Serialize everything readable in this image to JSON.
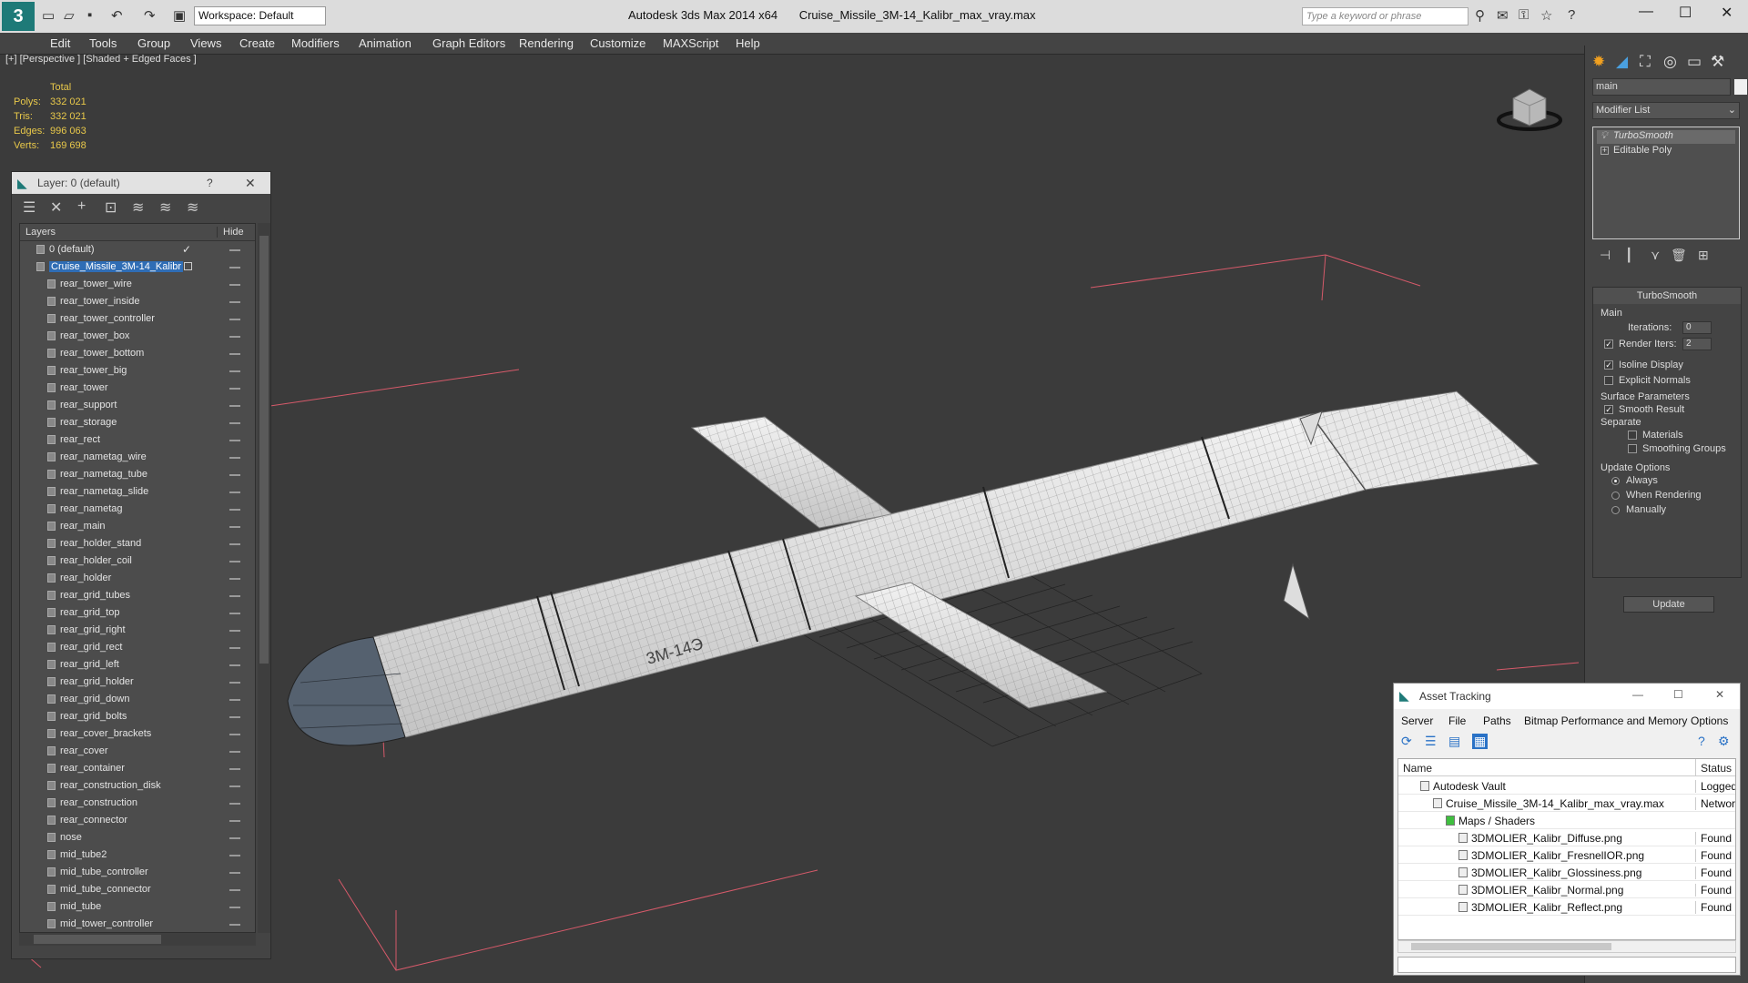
{
  "titlebar": {
    "app_title": "Autodesk 3ds Max  2014 x64",
    "file_title": "Cruise_Missile_3M-14_Kalibr_max_vray.max",
    "workspace_label": "Workspace: Default",
    "search_placeholder": "Type a keyword or phrase"
  },
  "menu": [
    "Edit",
    "Tools",
    "Group",
    "Views",
    "Create",
    "Modifiers",
    "Animation",
    "Graph Editors",
    "Rendering",
    "Customize",
    "MAXScript",
    "Help"
  ],
  "viewport": {
    "label": "[+] [Perspective ] [Shaded + Edged Faces ]",
    "stats_header": "Total",
    "stats": [
      {
        "k": "Polys:",
        "v": "332 021"
      },
      {
        "k": "Tris:",
        "v": "332 021"
      },
      {
        "k": "Edges:",
        "v": "996 063"
      },
      {
        "k": "Verts:",
        "v": "169 698"
      }
    ],
    "model_text": "3M-14Э"
  },
  "layer_panel": {
    "title": "Layer: 0 (default)",
    "help": "?",
    "col_layers": "Layers",
    "col_hide": "Hide",
    "rows": [
      {
        "name": "0 (default)",
        "level": 1,
        "check": true
      },
      {
        "name": "Cruise_Missile_3M-14_Kalibr",
        "level": 1,
        "selected": true
      },
      {
        "name": "rear_tower_wire",
        "level": 2
      },
      {
        "name": "rear_tower_inside",
        "level": 2
      },
      {
        "name": "rear_tower_controller",
        "level": 2
      },
      {
        "name": "rear_tower_box",
        "level": 2
      },
      {
        "name": "rear_tower_bottom",
        "level": 2
      },
      {
        "name": "rear_tower_big",
        "level": 2
      },
      {
        "name": "rear_tower",
        "level": 2
      },
      {
        "name": "rear_support",
        "level": 2
      },
      {
        "name": "rear_storage",
        "level": 2
      },
      {
        "name": "rear_rect",
        "level": 2
      },
      {
        "name": "rear_nametag_wire",
        "level": 2
      },
      {
        "name": "rear_nametag_tube",
        "level": 2
      },
      {
        "name": "rear_nametag_slide",
        "level": 2
      },
      {
        "name": "rear_nametag",
        "level": 2
      },
      {
        "name": "rear_main",
        "level": 2
      },
      {
        "name": "rear_holder_stand",
        "level": 2
      },
      {
        "name": "rear_holder_coil",
        "level": 2
      },
      {
        "name": "rear_holder",
        "level": 2
      },
      {
        "name": "rear_grid_tubes",
        "level": 2
      },
      {
        "name": "rear_grid_top",
        "level": 2
      },
      {
        "name": "rear_grid_right",
        "level": 2
      },
      {
        "name": "rear_grid_rect",
        "level": 2
      },
      {
        "name": "rear_grid_left",
        "level": 2
      },
      {
        "name": "rear_grid_holder",
        "level": 2
      },
      {
        "name": "rear_grid_down",
        "level": 2
      },
      {
        "name": "rear_grid_bolts",
        "level": 2
      },
      {
        "name": "rear_cover_brackets",
        "level": 2
      },
      {
        "name": "rear_cover",
        "level": 2
      },
      {
        "name": "rear_container",
        "level": 2
      },
      {
        "name": "rear_construction_disk",
        "level": 2
      },
      {
        "name": "rear_construction",
        "level": 2
      },
      {
        "name": "rear_connector",
        "level": 2
      },
      {
        "name": "nose",
        "level": 2
      },
      {
        "name": "mid_tube2",
        "level": 2
      },
      {
        "name": "mid_tube_controller",
        "level": 2
      },
      {
        "name": "mid_tube_connector",
        "level": 2
      },
      {
        "name": "mid_tube",
        "level": 2
      },
      {
        "name": "mid_tower_controller",
        "level": 2
      }
    ]
  },
  "command_panel": {
    "object_name": "main",
    "modifier_list": "Modifier List",
    "stack": [
      "TurboSmooth",
      "Editable Poly"
    ],
    "rollout_title": "TurboSmooth",
    "main_label": "Main",
    "iterations_label": "Iterations:",
    "iterations_value": "0",
    "render_iters_label": "Render Iters:",
    "render_iters_value": "2",
    "isoline_label": "Isoline Display",
    "explicit_label": "Explicit Normals",
    "surface_label": "Surface Parameters",
    "smooth_label": "Smooth Result",
    "separate_label": "Separate",
    "materials_label": "Materials",
    "smoothing_label": "Smoothing Groups",
    "update_options_label": "Update Options",
    "always_label": "Always",
    "when_rendering_label": "When Rendering",
    "manually_label": "Manually",
    "update_button": "Update"
  },
  "asset_tracking": {
    "title": "Asset Tracking",
    "menu": [
      "Server",
      "File",
      "Paths",
      "Bitmap Performance and Memory",
      "Options"
    ],
    "col_name": "Name",
    "col_status": "Status",
    "rows": [
      {
        "name": "Autodesk Vault",
        "status": "Logged Out",
        "indent": 1
      },
      {
        "name": "Cruise_Missile_3M-14_Kalibr_max_vray.max",
        "status": "Network",
        "indent": 2
      },
      {
        "name": "Maps / Shaders",
        "status": "",
        "indent": 3
      },
      {
        "name": "3DMOLIER_Kalibr_Diffuse.png",
        "status": "Found",
        "indent": 4
      },
      {
        "name": "3DMOLIER_Kalibr_FresnelIOR.png",
        "status": "Found",
        "indent": 4
      },
      {
        "name": "3DMOLIER_Kalibr_Glossiness.png",
        "status": "Found",
        "indent": 4
      },
      {
        "name": "3DMOLIER_Kalibr_Normal.png",
        "status": "Found",
        "indent": 4
      },
      {
        "name": "3DMOLIER_Kalibr_Reflect.png",
        "status": "Found",
        "indent": 4
      }
    ]
  }
}
